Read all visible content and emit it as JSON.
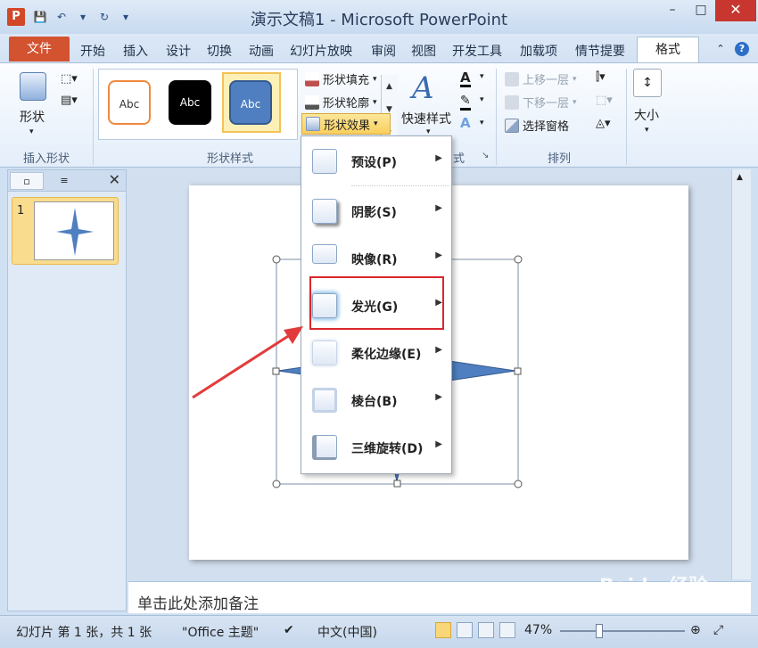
{
  "window": {
    "title": "演示文稿1 - Microsoft PowerPoint",
    "app_icon_letter": "P"
  },
  "tabs": {
    "file": "文件",
    "items": [
      "开始",
      "插入",
      "设计",
      "切换",
      "动画",
      "幻灯片放映",
      "审阅",
      "视图",
      "开发工具",
      "加载项",
      "情节提要"
    ],
    "active": "格式"
  },
  "ribbon": {
    "insert_shapes": {
      "shapes_label": "形状",
      "group_label": "插入形状"
    },
    "shape_styles": {
      "swatch_text": "Abc",
      "fill": "形状填充",
      "outline": "形状轮廓",
      "effects": "形状效果",
      "group_label": "形状样式"
    },
    "wordart": {
      "quick_styles": "快速样式",
      "group_label_partial": "式"
    },
    "arrange": {
      "bring_forward": "上移一层",
      "send_backward": "下移一层",
      "selection_pane": "选择窗格",
      "group_label": "排列"
    },
    "size": {
      "label": "大小"
    }
  },
  "menu": {
    "items": [
      {
        "label": "预设(P)"
      },
      {
        "label": "阴影(S)"
      },
      {
        "label": "映像(R)"
      },
      {
        "label": "发光(G)"
      },
      {
        "label": "柔化边缘(E)"
      },
      {
        "label": "棱台(B)"
      },
      {
        "label": "三维旋转(D)"
      }
    ]
  },
  "slide_pane": {
    "thumb_number": "1"
  },
  "notes": {
    "placeholder": "单击此处添加备注"
  },
  "status": {
    "slide_info": "幻灯片 第 1 张，共 1 张",
    "theme": "\"Office 主题\"",
    "language": "中文(中国)",
    "zoom": "47%"
  },
  "colors": {
    "file_tab": "#d35230",
    "shape_fill": "#4f7fc0",
    "highlight": "#d9262c"
  }
}
